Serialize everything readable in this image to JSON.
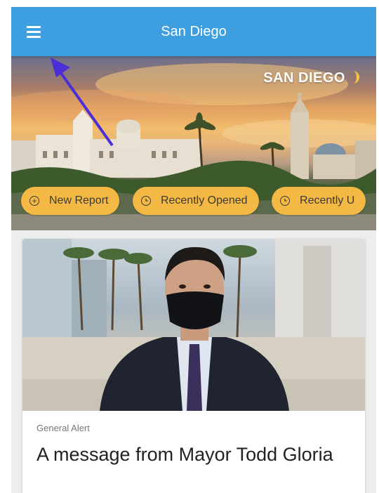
{
  "app_bar": {
    "title": "San Diego",
    "menu_icon": "hamburger-menu-icon"
  },
  "hero": {
    "logo_text": "SAN DIEGO"
  },
  "chips": [
    {
      "label": "New Report",
      "icon": "plus-circle-icon"
    },
    {
      "label": "Recently Opened",
      "icon": "clock-icon"
    },
    {
      "label": "Recently U",
      "icon": "clock-icon"
    }
  ],
  "card": {
    "category": "General Alert",
    "title": "A message from Mayor Todd Gloria"
  },
  "colors": {
    "app_bar": "#3e9fe0",
    "chip": "#f4b845",
    "annotation_arrow": "#4b2fd6"
  }
}
